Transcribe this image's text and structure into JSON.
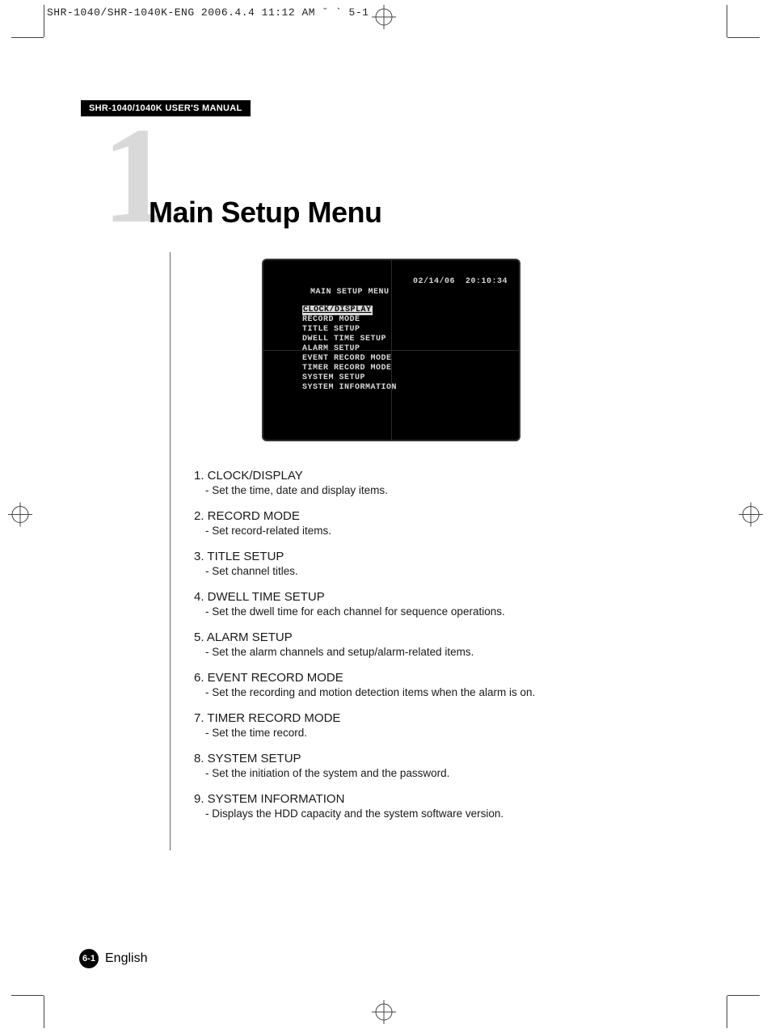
{
  "print_header": "SHR-1040/SHR-1040K-ENG 2006.4.4 11:12 AM ˘ ` 5-1",
  "manual_label": "SHR-1040/1040K USER'S MANUAL",
  "big_number": "1",
  "section_title": "Main Setup Menu",
  "screen": {
    "date": "02/14/06",
    "time": "20:10:34",
    "title": "MAIN SETUP MENU",
    "items": [
      "CLOCK/DISPLAY",
      "RECORD MODE",
      "TITLE SETUP",
      "DWELL TIME SETUP",
      "ALARM SETUP",
      "EVENT RECORD MODE",
      "TIMER RECORD MODE",
      "SYSTEM SETUP",
      "SYSTEM INFORMATION"
    ],
    "selected_index": 0
  },
  "descriptions": [
    {
      "n": "1",
      "title": "CLOCK/DISPLAY",
      "sub": "- Set the time, date and display items."
    },
    {
      "n": "2",
      "title": "RECORD MODE",
      "sub": "- Set record-related items."
    },
    {
      "n": "3",
      "title": "TITLE SETUP",
      "sub": "- Set channel titles."
    },
    {
      "n": "4",
      "title": "DWELL TIME SETUP",
      "sub": "- Set the dwell time for each channel for sequence operations."
    },
    {
      "n": "5",
      "title": "ALARM SETUP",
      "sub": "- Set the alarm channels and setup/alarm-related items."
    },
    {
      "n": "6",
      "title": "EVENT RECORD MODE",
      "sub": "- Set the recording and motion detection items when the alarm is on."
    },
    {
      "n": "7",
      "title": "TIMER RECORD MODE",
      "sub": "- Set the time record."
    },
    {
      "n": "8",
      "title": "SYSTEM SETUP",
      "sub": "- Set the initiation of the system and the password."
    },
    {
      "n": "9",
      "title": "SYSTEM INFORMATION",
      "sub": "- Displays the HDD capacity and the system software version."
    }
  ],
  "footer": {
    "page_badge": "6-1",
    "language": "English"
  }
}
